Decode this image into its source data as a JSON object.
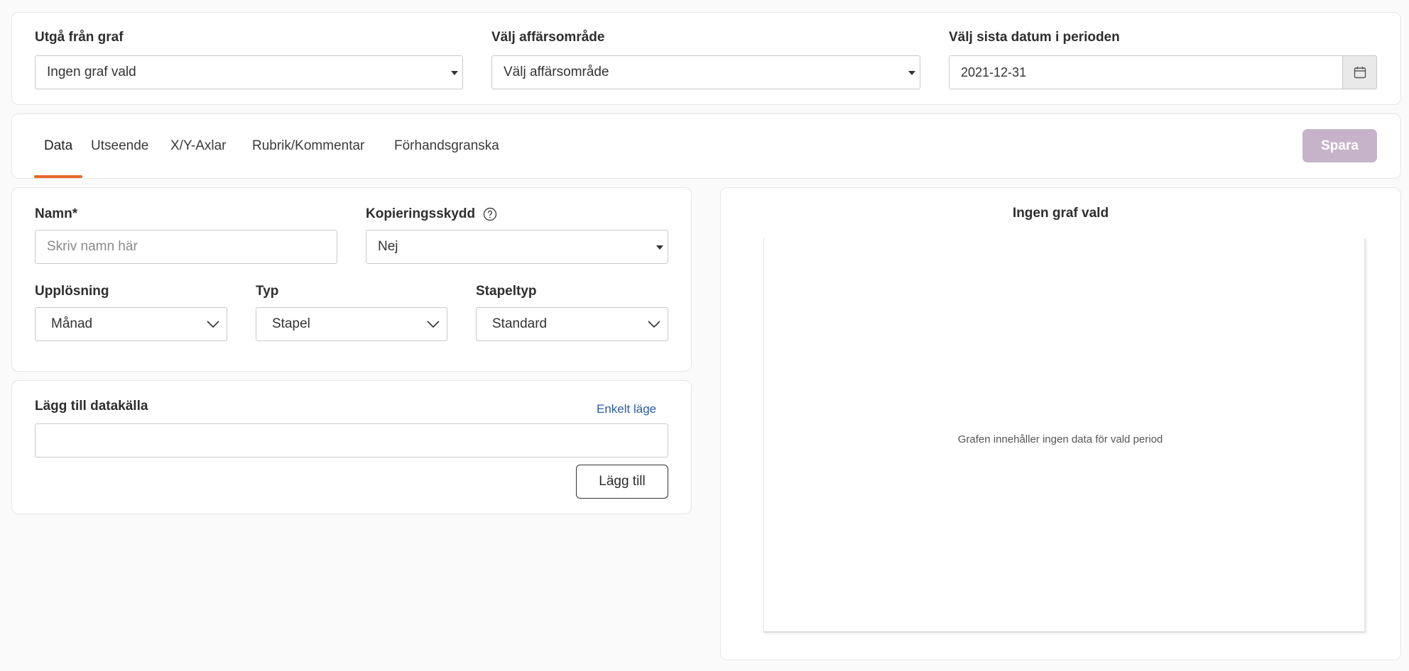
{
  "filters": {
    "graph_label": "Utgå från graf",
    "graph_value": "Ingen graf vald",
    "area_label": "Välj affärsområde",
    "area_value": "Välj affärsområde",
    "date_label": "Välj sista datum i perioden",
    "date_value": "2021-12-31"
  },
  "tabs": [
    {
      "label": "Data",
      "active": true
    },
    {
      "label": "Utseende"
    },
    {
      "label": "X/Y-Axlar"
    },
    {
      "label": "Rubrik/Kommentar"
    },
    {
      "label": "Förhandsgranska"
    }
  ],
  "save_label": "Spara",
  "form": {
    "name_label": "Namn*",
    "name_placeholder": "Skriv namn här",
    "copy_label": "Kopieringsskydd",
    "copy_value": "Nej",
    "resolution_label": "Upplösning",
    "resolution_value": "Månad",
    "type_label": "Typ",
    "type_value": "Stapel",
    "bartype_label": "Stapeltyp",
    "bartype_value": "Standard"
  },
  "datasource": {
    "title": "Lägg till datakälla",
    "mode_link": "Enkelt läge",
    "input_value": "",
    "add_label": "Lägg till"
  },
  "preview": {
    "title": "Ingen graf vald",
    "empty_message": "Grafen innehåller ingen data för vald period"
  },
  "colors": {
    "accent": "#e8662a",
    "save_bg": "#c7b3c9",
    "link": "#2a5aa0"
  },
  "icons": {
    "help": "help-circle-icon",
    "calendar": "calendar-icon",
    "caret": "caret-down-icon",
    "chevron": "chevron-down-icon"
  }
}
